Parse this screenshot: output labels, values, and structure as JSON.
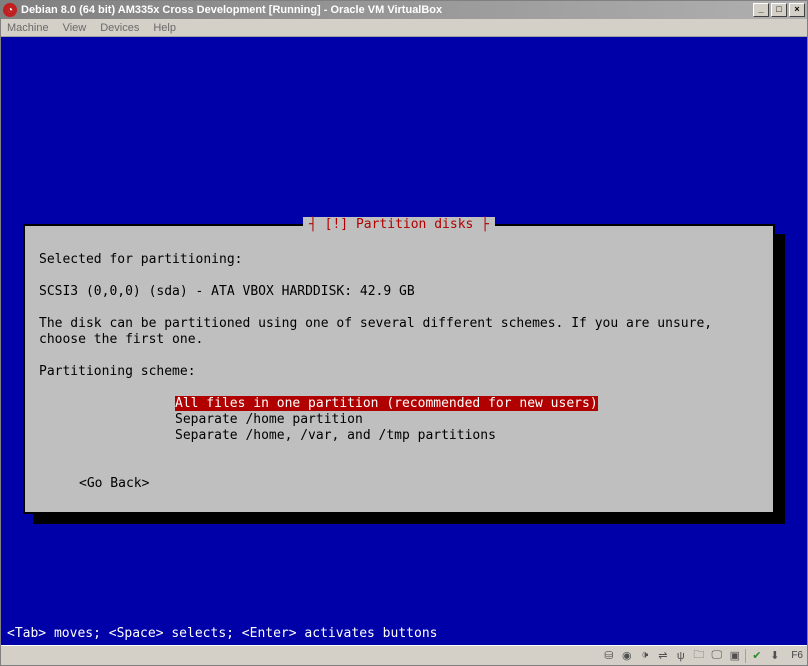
{
  "window": {
    "title": "Debian 8.0 (64 bit) AM335x Cross Development [Running] - Oracle VM VirtualBox",
    "controls": {
      "min": "_",
      "max": "□",
      "close": "×"
    }
  },
  "menubar": {
    "machine": "Machine",
    "view": "View",
    "devices": "Devices",
    "help": "Help"
  },
  "dialog": {
    "title": "[!] Partition disks",
    "heading": "Selected for partitioning:",
    "device": "SCSI3 (0,0,0) (sda) - ATA VBOX HARDDISK: 42.9 GB",
    "description": "The disk can be partitioned using one of several different schemes. If you are unsure,\nchoose the first one.",
    "scheme_label": "Partitioning scheme:",
    "options": [
      "All files in one partition (recommended for new users)",
      "Separate /home partition",
      "Separate /home, /var, and /tmp partitions"
    ],
    "go_back": "<Go Back>"
  },
  "hint_bar": "<Tab> moves; <Space> selects; <Enter> activates buttons",
  "statusbar": {
    "host_key": "F6"
  }
}
